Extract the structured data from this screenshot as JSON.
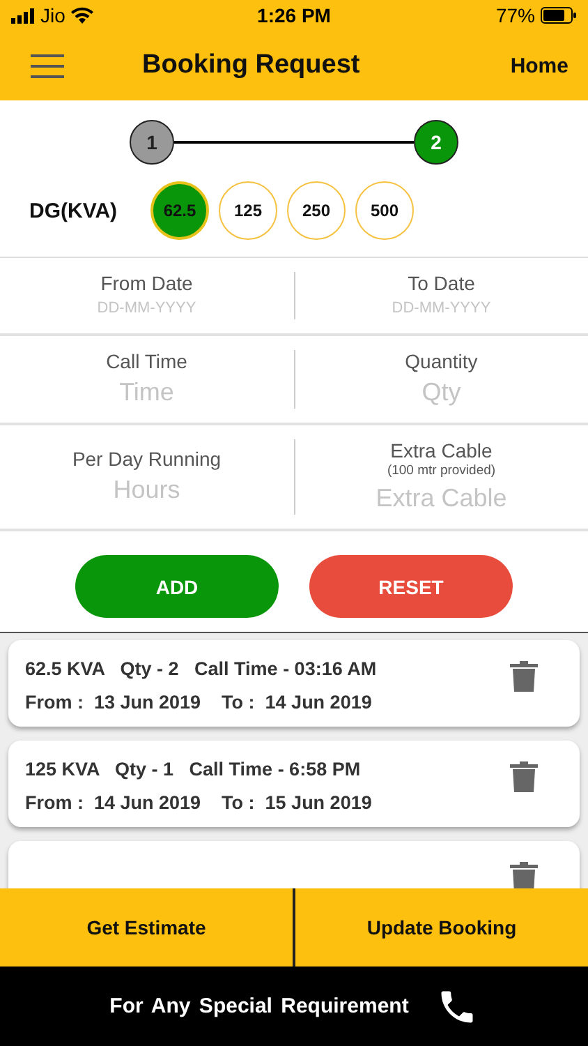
{
  "status_bar": {
    "carrier": "Jio",
    "time": "1:26 PM",
    "battery": "77%"
  },
  "header": {
    "title": "Booking Request",
    "action": "Home"
  },
  "steps": [
    {
      "label": "1",
      "selected": false
    },
    {
      "label": "2",
      "selected": true
    }
  ],
  "dg": {
    "label": "DG(KVA)",
    "options": [
      {
        "label": "62.5",
        "selected": true
      },
      {
        "label": "125",
        "selected": false
      },
      {
        "label": "250",
        "selected": false
      },
      {
        "label": "500",
        "selected": false
      }
    ]
  },
  "fields": [
    [
      {
        "label": "From Date",
        "placeholder": "DD-MM-YYYY",
        "kind": "date"
      },
      {
        "label": "To Date",
        "placeholder": "DD-MM-YYYY",
        "kind": "date"
      }
    ],
    [
      {
        "label": "Call Time",
        "placeholder": "Time",
        "kind": "text"
      },
      {
        "label": "Quantity",
        "placeholder": "Qty",
        "kind": "text"
      }
    ],
    [
      {
        "label": "Per Day Running",
        "placeholder": "Hours",
        "kind": "text"
      },
      {
        "label": "Extra Cable",
        "note": "(100 mtr provided)",
        "placeholder": "Extra Cable",
        "kind": "text"
      }
    ]
  ],
  "buttons": [
    {
      "label": "ADD",
      "kind": "add"
    },
    {
      "label": "RESET",
      "kind": "reset"
    }
  ],
  "bookings": [
    {
      "kind": "full",
      "summary": "62.5 KVA   Qty - 2   Call Time - 03:16 AM",
      "dates": "From :  13 Jun 2019    To :  14 Jun 2019"
    },
    {
      "kind": "full",
      "summary": "125 KVA   Qty - 1   Call Time - 6:58 PM",
      "dates": "From :  14 Jun 2019    To :  15 Jun 2019"
    },
    {
      "kind": "cut"
    }
  ],
  "actions": [
    "Get Estimate",
    "Update Booking"
  ],
  "footer": {
    "text": "For Any Special Requirement"
  }
}
